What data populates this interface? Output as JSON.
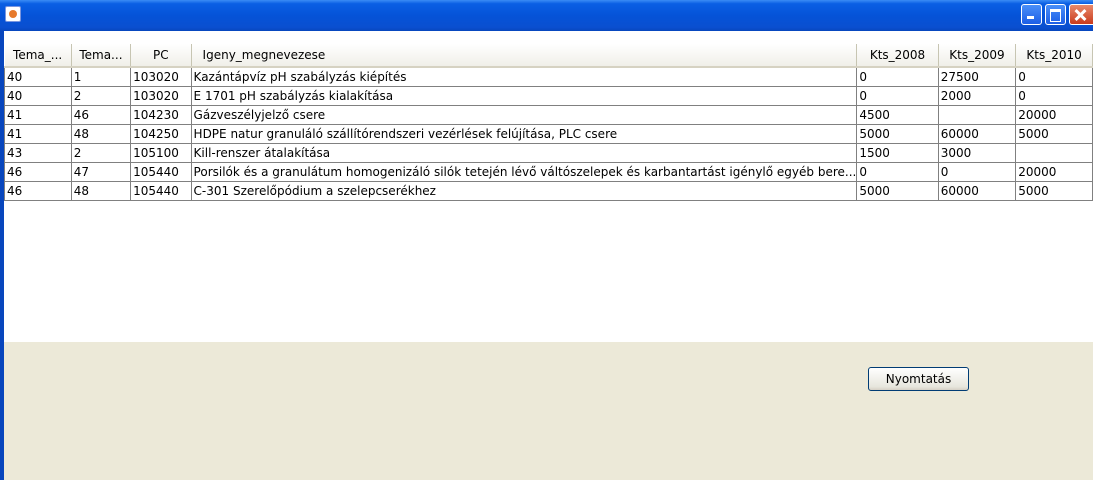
{
  "window": {
    "title": ""
  },
  "table": {
    "columns": [
      "Tema_...",
      "Tema...",
      "PC",
      "Igeny_megnevezese",
      "Kts_2008",
      "Kts_2009",
      "Kts_2010"
    ],
    "rows": [
      [
        "40",
        "1",
        "103020",
        "Kazántápvíz pH szabályzás kiépítés",
        "0",
        "27500",
        "0"
      ],
      [
        "40",
        "2",
        "103020",
        "E 1701 pH szabályzás kialakítása",
        "0",
        "2000",
        "0"
      ],
      [
        "41",
        "46",
        "104230",
        "Gázveszélyjelző csere",
        "4500",
        "",
        "20000"
      ],
      [
        "41",
        "48",
        "104250",
        "HDPE natur granuláló szállítórendszeri vezérlések felújítása, PLC csere",
        "5000",
        "60000",
        "5000"
      ],
      [
        "43",
        "2",
        "105100",
        "Kill-renszer átalakítása",
        "1500",
        "3000",
        ""
      ],
      [
        "46",
        "47",
        "105440",
        "Porsilók és a granulátum homogenizáló silók tetején lévő váltószelepek és karbantartást igénylő egyéb bere...",
        "0",
        "0",
        "20000"
      ],
      [
        "46",
        "48",
        "105440",
        "C-301 Szerelőpódium a szelepcserékhez",
        "5000",
        "60000",
        "5000"
      ]
    ]
  },
  "buttons": {
    "print": "Nyomtatás"
  }
}
